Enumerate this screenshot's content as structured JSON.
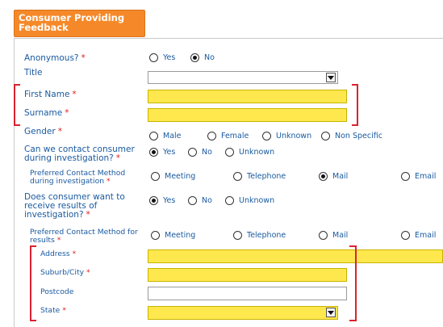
{
  "section": {
    "title": "Consumer Providing Feedback"
  },
  "required_marker": "*",
  "fields": {
    "anonymous": {
      "label": "Anonymous?",
      "options": [
        "Yes",
        "No"
      ],
      "selected": "No"
    },
    "title": {
      "label": "Title",
      "value": ""
    },
    "first_name": {
      "label": "First Name",
      "value": ""
    },
    "surname": {
      "label": "Surname",
      "value": ""
    },
    "gender": {
      "label": "Gender",
      "options": [
        "Male",
        "Female",
        "Unknown",
        "Non Specific"
      ],
      "selected": ""
    },
    "contact_during": {
      "label": "Can we contact consumer during investigation?",
      "options": [
        "Yes",
        "No",
        "Unknown"
      ],
      "selected": "Yes"
    },
    "contact_method_during": {
      "label": "Preferred Contact Method during investigation",
      "options": [
        "Meeting",
        "Telephone",
        "Mail",
        "Email"
      ],
      "selected": "Mail"
    },
    "receive_results": {
      "label": "Does consumer want to receive results of investigation?",
      "options": [
        "Yes",
        "No",
        "Unknown"
      ],
      "selected": "Yes"
    },
    "contact_method_results": {
      "label": "Preferred Contact Method for results",
      "options": [
        "Meeting",
        "Telephone",
        "Mail",
        "Email"
      ],
      "selected": ""
    },
    "address": {
      "label": "Address",
      "value": ""
    },
    "suburb": {
      "label": "Suburb/City",
      "value": ""
    },
    "postcode": {
      "label": "Postcode",
      "value": ""
    },
    "state": {
      "label": "State",
      "value": ""
    }
  },
  "colors": {
    "header": "#f5892a",
    "label": "#1a5aa0",
    "required": "#e02020",
    "mandatory_fill": "#ffe84d",
    "highlight": "#d9232e"
  }
}
